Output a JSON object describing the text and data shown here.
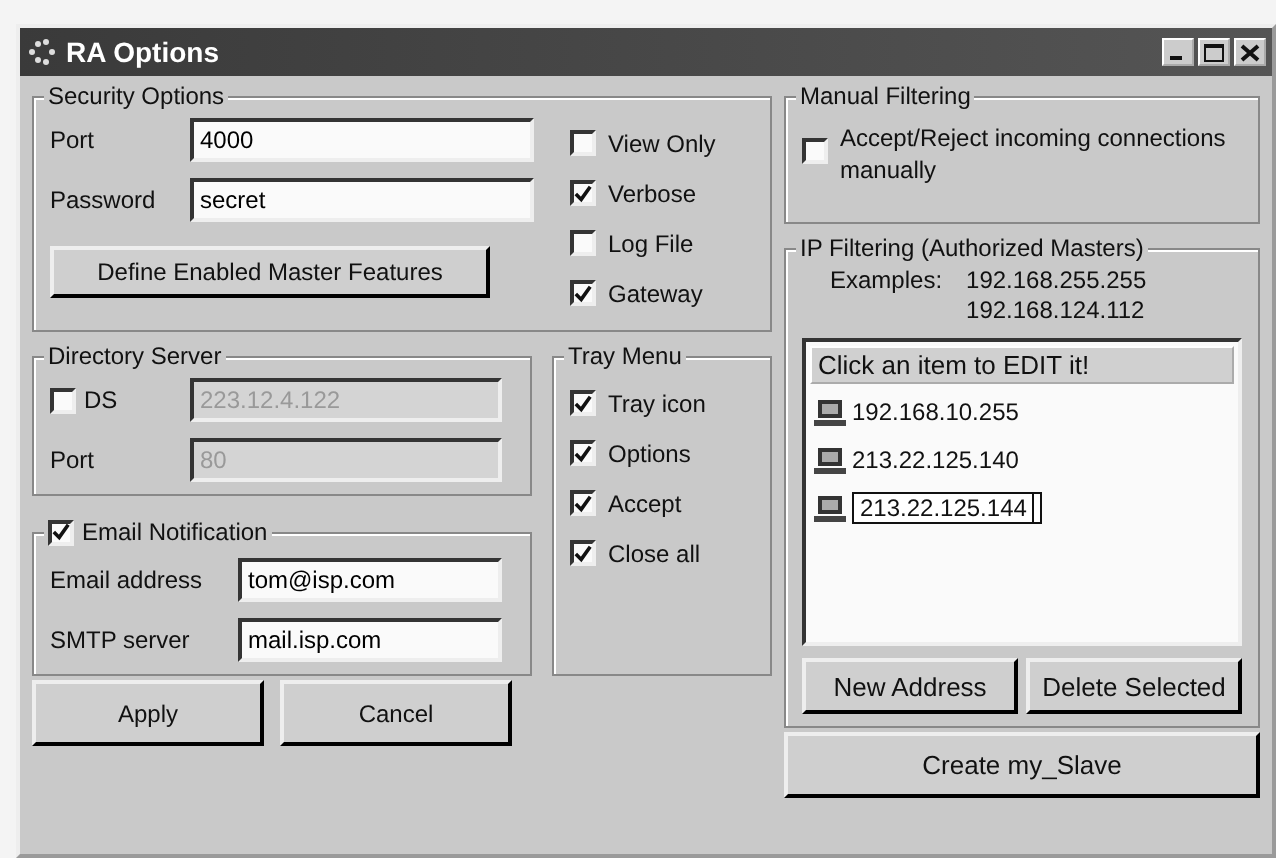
{
  "window": {
    "title": "RA Options"
  },
  "security_options": {
    "title": "Security Options",
    "port": {
      "label": "Port",
      "value": "4000"
    },
    "password": {
      "label": "Password",
      "value": "secret"
    },
    "define_button": "Define Enabled Master Features",
    "checkboxes": [
      {
        "label": "View Only",
        "checked": false
      },
      {
        "label": "Verbose",
        "checked": true
      },
      {
        "label": "Log File",
        "checked": false
      },
      {
        "label": "Gateway",
        "checked": true
      }
    ]
  },
  "directory_server": {
    "title": "Directory Server",
    "ds": {
      "label": "DS",
      "checked": false,
      "value": "223.12.4.122",
      "disabled": true
    },
    "port": {
      "label": "Port",
      "value": "80",
      "disabled": true
    }
  },
  "email_notification": {
    "label": "Email Notification",
    "checked": true,
    "email_address": {
      "label": "Email address",
      "value": "tom@isp.com"
    },
    "smtp_server": {
      "label": "SMTP server",
      "value": "mail.isp.com"
    }
  },
  "tray_menu": {
    "title": "Tray Menu",
    "items": [
      {
        "label": "Tray icon",
        "checked": true
      },
      {
        "label": "Options",
        "checked": true
      },
      {
        "label": "Accept",
        "checked": true
      },
      {
        "label": "Close all",
        "checked": true
      }
    ]
  },
  "buttons": [
    "Apply",
    "Cancel"
  ],
  "manual_filtering": {
    "title": "Manual Filtering",
    "checkbox": {
      "label": "Accept/Reject incoming connections manually",
      "checked": false
    }
  },
  "ip_filtering": {
    "title": "IP Filtering (Authorized Masters)",
    "examples_label": "Examples:",
    "examples": [
      "192.168.255.255",
      "192.168.124.112"
    ],
    "list": {
      "header": "Click an item to EDIT it!",
      "items": [
        {
          "address": "192.168.10.255",
          "editing": false
        },
        {
          "address": "213.22.125.140",
          "editing": false
        },
        {
          "address": "213.22.125.144",
          "editing": true
        }
      ]
    },
    "buttons": [
      "New Address",
      "Delete Selected"
    ]
  },
  "create_button": "Create my_Slave"
}
